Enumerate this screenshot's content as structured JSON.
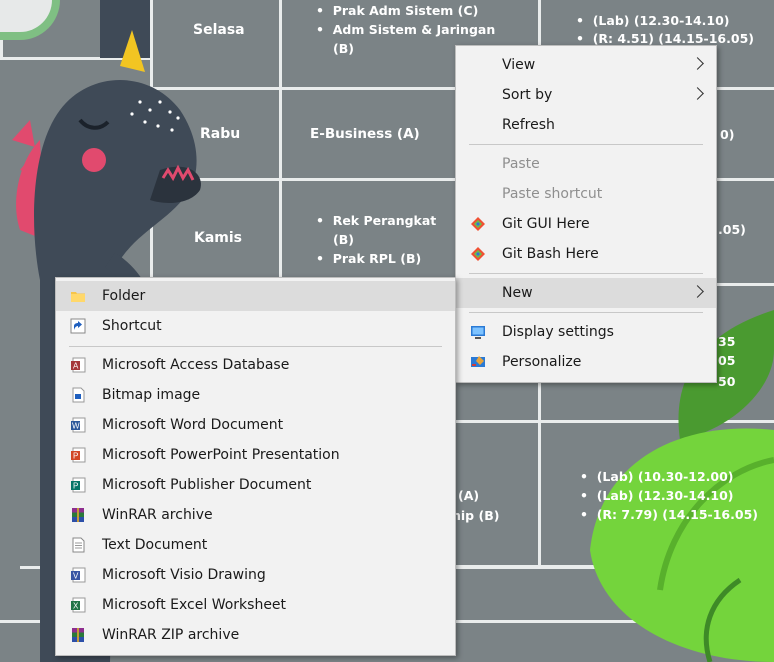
{
  "schedule": {
    "days": [
      "Selasa",
      "Rabu",
      "Kamis"
    ],
    "selasa_courses": [
      "Prak Adm Sistem (C)",
      "Adm Sistem & Jaringan",
      "(B)"
    ],
    "selasa_times": [
      "(Lab) (12.30-14.10)",
      "(R: 4.51) (14.15-16.05)"
    ],
    "rabu_course": "E-Business (A)",
    "rabu_time_suffix": "0)",
    "kamis_courses": [
      "Rek   Perangkat",
      "(B)",
      "Prak RPL (B)"
    ],
    "kamis_time_suffix": ".05)",
    "right_fragments": [
      "35",
      "05",
      "50"
    ],
    "lower_fragments": [
      "(A)",
      "nip (B)"
    ],
    "lower_times": [
      "(Lab) (10.30-12.00)",
      "(Lab) (12.30-14.10)",
      "(R: 7.79) (14.15-16.05)"
    ]
  },
  "context_menu": {
    "items": [
      {
        "label": "View",
        "submenu": true
      },
      {
        "label": "Sort by",
        "submenu": true
      },
      {
        "label": "Refresh"
      },
      {
        "label": "Paste",
        "disabled": true
      },
      {
        "label": "Paste shortcut",
        "disabled": true
      },
      {
        "label": "Git GUI Here",
        "icon": "git-gui-icon"
      },
      {
        "label": "Git Bash Here",
        "icon": "git-bash-icon"
      },
      {
        "label": "New",
        "submenu": true,
        "highlighted": true
      },
      {
        "label": "Display settings",
        "icon": "display-icon"
      },
      {
        "label": "Personalize",
        "icon": "personalize-icon"
      }
    ]
  },
  "new_menu": {
    "items": [
      {
        "label": "Folder",
        "icon": "folder-icon"
      },
      {
        "label": "Shortcut",
        "icon": "shortcut-icon"
      },
      {
        "label": "Microsoft Access Database",
        "icon": "access-icon"
      },
      {
        "label": "Bitmap image",
        "icon": "bitmap-icon"
      },
      {
        "label": "Microsoft Word Document",
        "icon": "word-icon"
      },
      {
        "label": "Microsoft PowerPoint Presentation",
        "icon": "powerpoint-icon"
      },
      {
        "label": "Microsoft Publisher Document",
        "icon": "publisher-icon"
      },
      {
        "label": "WinRAR archive",
        "icon": "winrar-icon"
      },
      {
        "label": "Text Document",
        "icon": "text-document-icon"
      },
      {
        "label": "Microsoft Visio Drawing",
        "icon": "visio-icon"
      },
      {
        "label": "Microsoft Excel Worksheet",
        "icon": "excel-icon"
      },
      {
        "label": "WinRAR ZIP archive",
        "icon": "winrar-zip-icon"
      }
    ]
  },
  "colors": {
    "desktop": "#7b8386",
    "menu_bg": "#f2f2f2",
    "dino": "#3f4a57",
    "leaf": "#6fcf3a",
    "highlight": "#dcdcdc"
  }
}
